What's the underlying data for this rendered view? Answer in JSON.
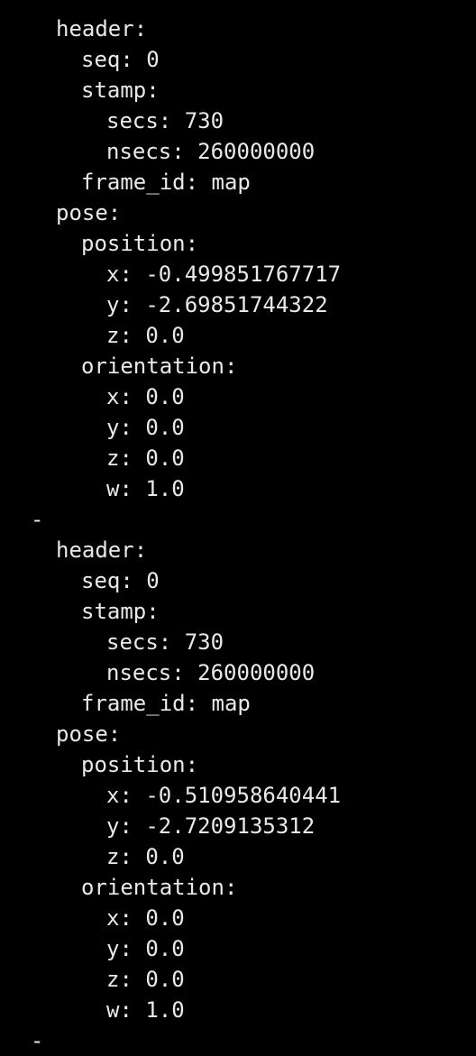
{
  "messages": [
    {
      "header_key": "header:",
      "seq": "seq: 0",
      "stamp_key": "stamp:",
      "secs": "secs: 730",
      "nsecs": "nsecs: 260000000",
      "frame_id": "frame_id: map",
      "pose_key": "pose:",
      "position_key": "position:",
      "pos_x": "x: -0.499851767717",
      "pos_y": "y: -2.69851744322",
      "pos_z": "z: 0.0",
      "orientation_key": "orientation:",
      "ori_x": "x: 0.0",
      "ori_y": "y: 0.0",
      "ori_z": "z: 0.0",
      "ori_w": "w: 1.0",
      "separator": "-"
    },
    {
      "header_key": "header:",
      "seq": "seq: 0",
      "stamp_key": "stamp:",
      "secs": "secs: 730",
      "nsecs": "nsecs: 260000000",
      "frame_id": "frame_id: map",
      "pose_key": "pose:",
      "position_key": "position:",
      "pos_x": "x: -0.510958640441",
      "pos_y": "y: -2.7209135312",
      "pos_z": "z: 0.0",
      "orientation_key": "orientation:",
      "ori_x": "x: 0.0",
      "ori_y": "y: 0.0",
      "ori_z": "z: 0.0",
      "ori_w": "w: 1.0",
      "separator": "-"
    }
  ]
}
